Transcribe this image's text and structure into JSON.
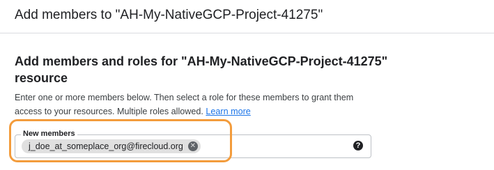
{
  "header": {
    "title": "Add members to \"AH-My-NativeGCP-Project-41275\""
  },
  "section": {
    "heading": "Add members and roles for \"AH-My-NativeGCP-Project-41275\" resource",
    "description": "Enter one or more members below. Then select a role for these members to grant them access to your resources. Multiple roles allowed.",
    "learn_more": "Learn more"
  },
  "members_field": {
    "label": "New members",
    "chips": [
      {
        "text": "j_doe_at_someplace_org@firecloud.org",
        "remove_glyph": "✕"
      }
    ],
    "help_glyph": "?"
  },
  "icons": {
    "chip_remove": "close-icon",
    "help": "help-icon"
  },
  "colors": {
    "link": "#1a73e8",
    "highlight": "#f39c3c",
    "chip_bg": "#e0e0e0"
  }
}
